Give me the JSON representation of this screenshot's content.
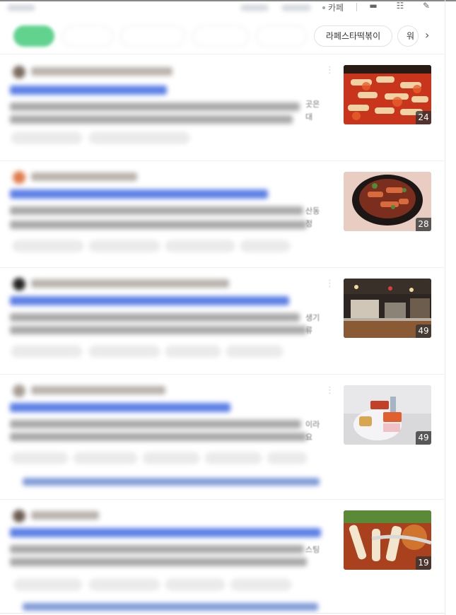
{
  "toolbar": {
    "cafe_label": "카페",
    "icons": [
      "list-view-icon",
      "grid-view-icon",
      "edit-icon"
    ]
  },
  "chips": {
    "visible_label": "라페스타떡볶이",
    "partial_label": "워",
    "next_icon": "chevron-right-icon"
  },
  "results": [
    {
      "thumb_count": "24",
      "edge_text": [
        "곳은",
        "대"
      ]
    },
    {
      "thumb_count": "28",
      "edge_text": [
        "산동",
        "정"
      ]
    },
    {
      "thumb_count": "49",
      "edge_text": [
        "생기",
        "류"
      ]
    },
    {
      "thumb_count": "49",
      "edge_text": [
        "이라",
        "요"
      ]
    },
    {
      "thumb_count": "19",
      "edge_text": [
        "스팅",
        ""
      ]
    }
  ],
  "colors": {
    "accent_green": "#2dc46a",
    "link_blue": "#5b7fe6",
    "badge_bg": "#323232"
  }
}
